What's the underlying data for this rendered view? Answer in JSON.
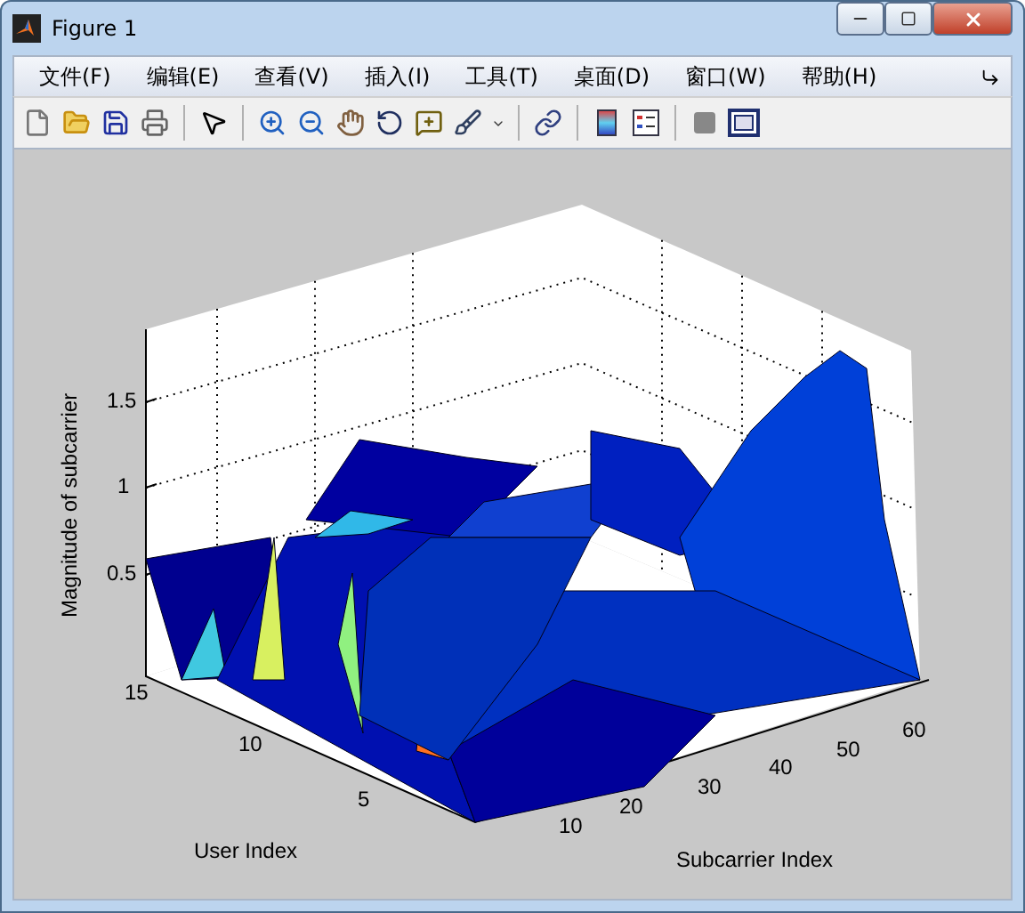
{
  "window": {
    "title": "Figure 1"
  },
  "menu": [
    {
      "label": "文件(F)"
    },
    {
      "label": "编辑(E)"
    },
    {
      "label": "查看(V)"
    },
    {
      "label": "插入(I)"
    },
    {
      "label": "工具(T)"
    },
    {
      "label": "桌面(D)"
    },
    {
      "label": "窗口(W)"
    },
    {
      "label": "帮助(H)"
    }
  ],
  "plot": {
    "zlabel": "Magnitude of subcarrier",
    "ylabel": "User Index",
    "xlabel": "Subcarrier Index",
    "z_ticks": [
      "1.5",
      "1",
      "0.5"
    ],
    "y_ticks": [
      "15",
      "10",
      "5"
    ],
    "x_ticks": [
      "10",
      "20",
      "30",
      "40",
      "50",
      "60"
    ]
  }
}
